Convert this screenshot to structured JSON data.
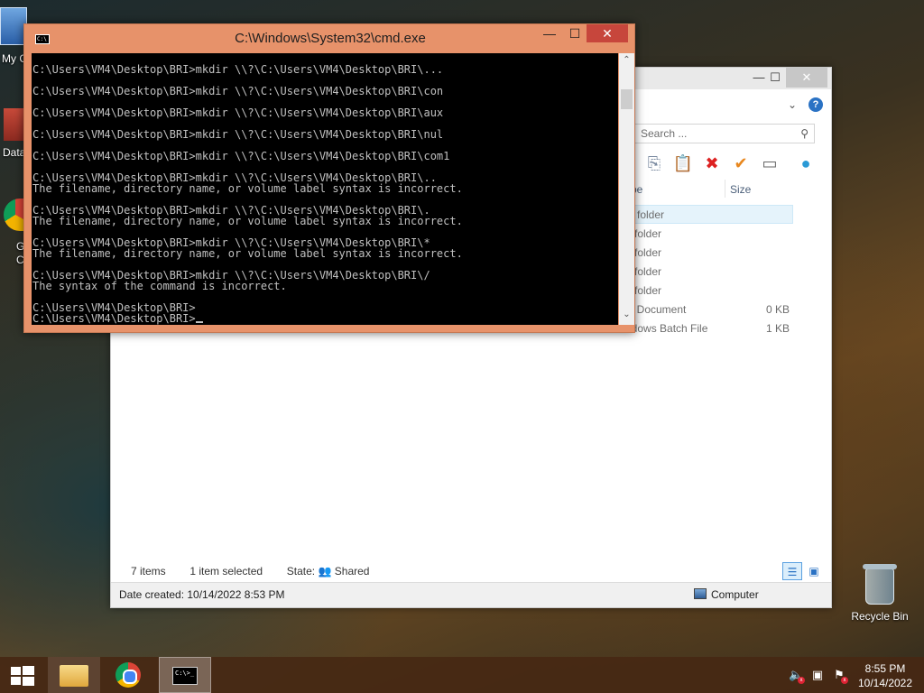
{
  "desktop": {
    "icons": {
      "my_computer": "My C",
      "data": "Data",
      "chrome_line1": "G",
      "chrome_line2": "C"
    },
    "recycle_bin": "Recycle Bin"
  },
  "explorer": {
    "minimize": "—",
    "maximize": "☐",
    "close": "✕",
    "help": "?",
    "search_placeholder": "Search ...",
    "columns": {
      "type": "pe",
      "size": "Size"
    },
    "rows": [
      {
        "type": "e folder",
        "size": ""
      },
      {
        "type": "e folder",
        "size": ""
      },
      {
        "type": "e folder",
        "size": ""
      },
      {
        "type": "e folder",
        "size": ""
      },
      {
        "type": "e folder",
        "size": ""
      },
      {
        "type": "xt Document",
        "size": "0 KB"
      },
      {
        "type": "ndows Batch File",
        "size": "1 KB"
      }
    ],
    "status": {
      "items": "7 items",
      "selected": "1 item selected",
      "state_label": "State:",
      "state_value": "Shared"
    },
    "details": {
      "date_created": "Date created: 10/14/2022 8:53 PM",
      "computer": "Computer"
    }
  },
  "cmd": {
    "title": "C:\\Windows\\System32\\cmd.exe",
    "icon_text": "C:\\",
    "minimize": "—",
    "maximize": "☐",
    "close": "✕",
    "lines": [
      "C:\\Users\\VM4\\Desktop\\BRI>mkdir \\\\?\\C:\\Users\\VM4\\Desktop\\BRI\\...",
      "",
      "C:\\Users\\VM4\\Desktop\\BRI>mkdir \\\\?\\C:\\Users\\VM4\\Desktop\\BRI\\con",
      "",
      "C:\\Users\\VM4\\Desktop\\BRI>mkdir \\\\?\\C:\\Users\\VM4\\Desktop\\BRI\\aux",
      "",
      "C:\\Users\\VM4\\Desktop\\BRI>mkdir \\\\?\\C:\\Users\\VM4\\Desktop\\BRI\\nul",
      "",
      "C:\\Users\\VM4\\Desktop\\BRI>mkdir \\\\?\\C:\\Users\\VM4\\Desktop\\BRI\\com1",
      "",
      "C:\\Users\\VM4\\Desktop\\BRI>mkdir \\\\?\\C:\\Users\\VM4\\Desktop\\BRI\\..",
      "The filename, directory name, or volume label syntax is incorrect.",
      "",
      "C:\\Users\\VM4\\Desktop\\BRI>mkdir \\\\?\\C:\\Users\\VM4\\Desktop\\BRI\\.",
      "The filename, directory name, or volume label syntax is incorrect.",
      "",
      "C:\\Users\\VM4\\Desktop\\BRI>mkdir \\\\?\\C:\\Users\\VM4\\Desktop\\BRI\\*",
      "The filename, directory name, or volume label syntax is incorrect.",
      "",
      "C:\\Users\\VM4\\Desktop\\BRI>mkdir \\\\?\\C:\\Users\\VM4\\Desktop\\BRI\\/",
      "The syntax of the command is incorrect.",
      "",
      "C:\\Users\\VM4\\Desktop\\BRI>",
      "C:\\Users\\VM4\\Desktop\\BRI>"
    ]
  },
  "taskbar": {
    "cmd_icon_text": "C:\\>_",
    "time": "8:55 PM",
    "date": "10/14/2022"
  }
}
